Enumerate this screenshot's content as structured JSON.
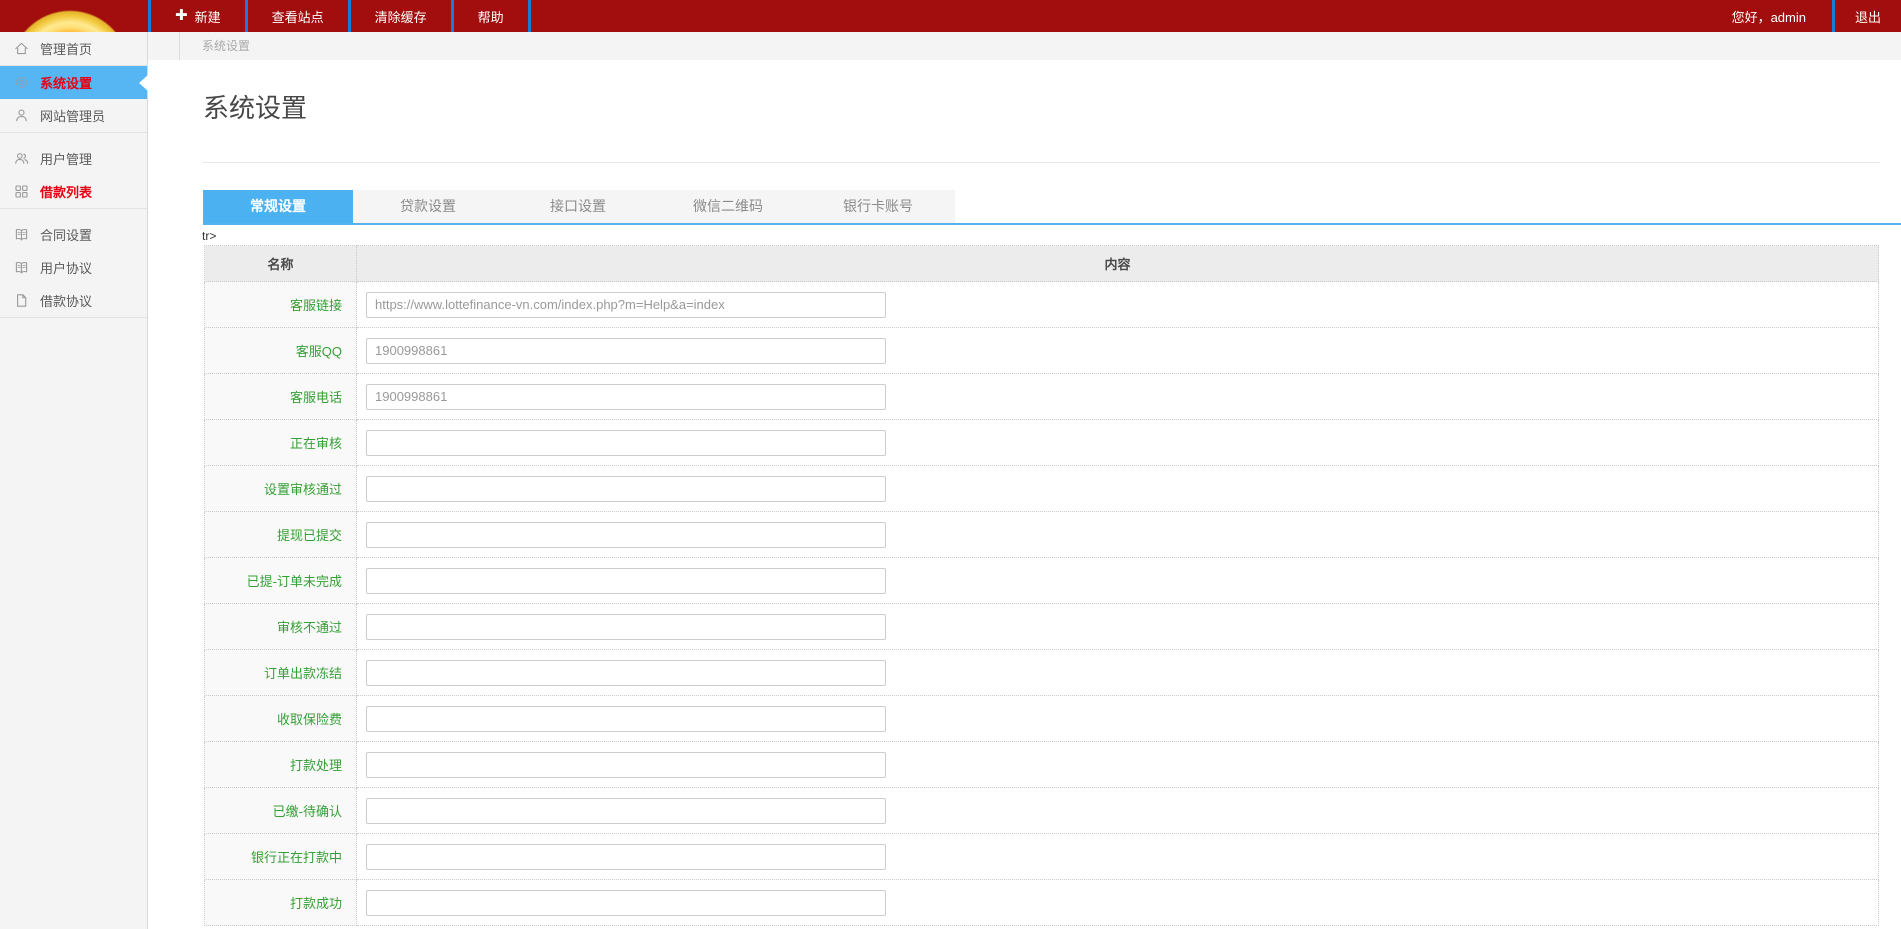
{
  "colors": {
    "topbar_red": "#a20d0d",
    "separator_blue": "#1a7cd8",
    "highlight_blue": "#56b6f3",
    "active_tab_blue": "#4cb1f0",
    "accent_red": "#e60012",
    "label_green": "#35a035"
  },
  "topbar": {
    "buttons": [
      {
        "label": "新建",
        "icon": "plus-icon"
      },
      {
        "label": "查看站点"
      },
      {
        "label": "清除缓存"
      },
      {
        "label": "帮助"
      }
    ],
    "greeting": "您好，admin",
    "logout_label": "退出"
  },
  "sidebar": {
    "groups": [
      {
        "items": [
          {
            "label": "管理首页",
            "icon": "home-icon"
          }
        ]
      },
      {
        "items": [
          {
            "label": "系统设置",
            "icon": "gear-icon",
            "active": true,
            "red": true
          },
          {
            "label": "网站管理员",
            "icon": "user-icon"
          }
        ]
      },
      {
        "items": [
          {
            "label": "用户管理",
            "icon": "users-icon"
          },
          {
            "label": "借款列表",
            "icon": "grid-icon",
            "red": true
          }
        ]
      },
      {
        "items": [
          {
            "label": "合同设置",
            "icon": "book-icon"
          },
          {
            "label": "用户协议",
            "icon": "book-icon"
          },
          {
            "label": "借款协议",
            "icon": "file-icon"
          }
        ]
      }
    ]
  },
  "breadcrumb": "系统设置",
  "page": {
    "title": "系统设置",
    "stray_text": "tr>"
  },
  "tabs": [
    {
      "label": "常规设置",
      "active": true
    },
    {
      "label": "贷款设置"
    },
    {
      "label": "接口设置"
    },
    {
      "label": "微信二维码"
    },
    {
      "label": "银行卡账号"
    }
  ],
  "table": {
    "headers": {
      "name": "名称",
      "content": "内容"
    },
    "rows": [
      {
        "label": "客服链接",
        "value": "https://www.lottefinance-vn.com/index.php?m=Help&a=index"
      },
      {
        "label": "客服QQ",
        "value": "1900998861"
      },
      {
        "label": "客服电话",
        "value": "1900998861"
      },
      {
        "label": "正在审核",
        "value": ""
      },
      {
        "label": "设置审核通过",
        "value": ""
      },
      {
        "label": "提现已提交",
        "value": ""
      },
      {
        "label": "已提-订单未完成",
        "value": ""
      },
      {
        "label": "审核不通过",
        "value": ""
      },
      {
        "label": "订单出款冻结",
        "value": ""
      },
      {
        "label": "收取保险费",
        "value": ""
      },
      {
        "label": "打款处理",
        "value": ""
      },
      {
        "label": "已缴-待确认",
        "value": ""
      },
      {
        "label": "银行正在打款中",
        "value": ""
      },
      {
        "label": "打款成功",
        "value": ""
      }
    ]
  }
}
